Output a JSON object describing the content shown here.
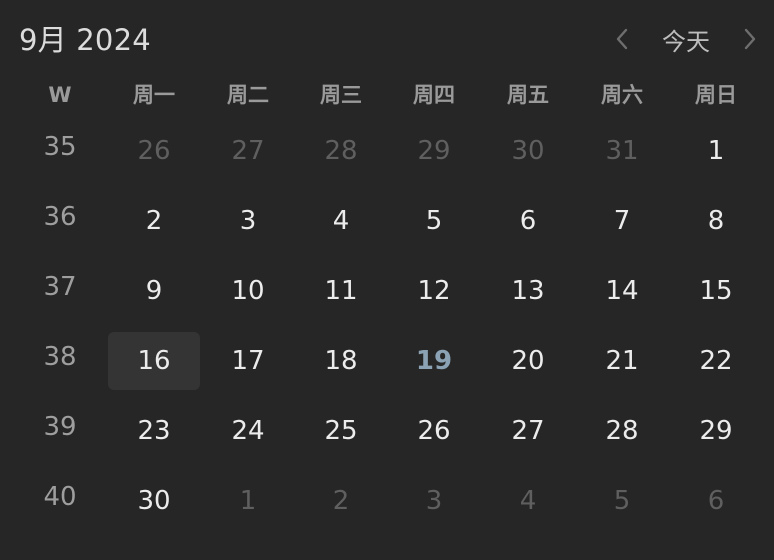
{
  "header": {
    "month_label": "9月 2024",
    "today_label": "今天",
    "prev_icon": "chevron-left-icon",
    "next_icon": "chevron-right-icon"
  },
  "weekdays": [
    "W",
    "周一",
    "周二",
    "周三",
    "周四",
    "周五",
    "周六",
    "周日"
  ],
  "weeks": [
    {
      "week": "35",
      "days": [
        {
          "d": "26",
          "muted": true
        },
        {
          "d": "27",
          "muted": true
        },
        {
          "d": "28",
          "muted": true
        },
        {
          "d": "29",
          "muted": true
        },
        {
          "d": "30",
          "muted": true
        },
        {
          "d": "31",
          "muted": true
        },
        {
          "d": "1"
        }
      ]
    },
    {
      "week": "36",
      "days": [
        {
          "d": "2"
        },
        {
          "d": "3"
        },
        {
          "d": "4"
        },
        {
          "d": "5"
        },
        {
          "d": "6"
        },
        {
          "d": "7"
        },
        {
          "d": "8"
        }
      ]
    },
    {
      "week": "37",
      "days": [
        {
          "d": "9"
        },
        {
          "d": "10"
        },
        {
          "d": "11"
        },
        {
          "d": "12"
        },
        {
          "d": "13"
        },
        {
          "d": "14"
        },
        {
          "d": "15"
        }
      ]
    },
    {
      "week": "38",
      "days": [
        {
          "d": "16",
          "selected": true
        },
        {
          "d": "17"
        },
        {
          "d": "18"
        },
        {
          "d": "19",
          "today": true
        },
        {
          "d": "20"
        },
        {
          "d": "21"
        },
        {
          "d": "22"
        }
      ]
    },
    {
      "week": "39",
      "days": [
        {
          "d": "23"
        },
        {
          "d": "24"
        },
        {
          "d": "25"
        },
        {
          "d": "26"
        },
        {
          "d": "27"
        },
        {
          "d": "28"
        },
        {
          "d": "29"
        }
      ]
    },
    {
      "week": "40",
      "days": [
        {
          "d": "30"
        },
        {
          "d": "1",
          "muted": true
        },
        {
          "d": "2",
          "muted": true
        },
        {
          "d": "3",
          "muted": true
        },
        {
          "d": "4",
          "muted": true
        },
        {
          "d": "5",
          "muted": true
        },
        {
          "d": "6",
          "muted": true
        }
      ]
    }
  ],
  "colors": {
    "background": "#262626",
    "text": "#ececec",
    "muted": "#5f5f5f",
    "today": "#8aa2b3",
    "selected_bg": "#343434"
  }
}
